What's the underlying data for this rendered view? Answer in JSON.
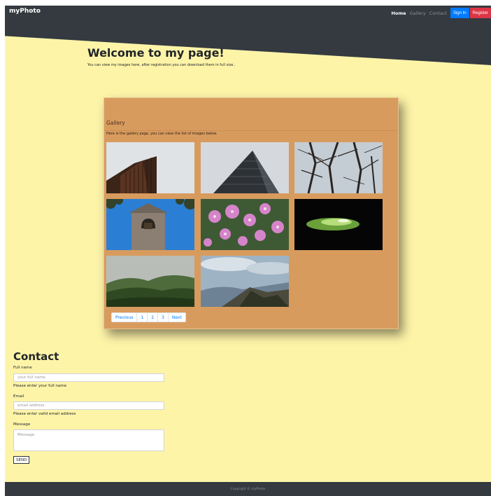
{
  "navbar": {
    "brand": "myPhoto",
    "links": [
      "Home",
      "Gallery",
      "Contact"
    ],
    "signin_label": "Sign In",
    "register_label": "Register"
  },
  "hero": {
    "title": "Welcome to my page!",
    "subtitle": "You can view my images here, after registration you can download them in full size.."
  },
  "gallery": {
    "title": "Gallery",
    "description": "Here is the gallery page, you can view the list of images below.",
    "images": [
      "tall-brown-building-photo",
      "glass-skyscraper-photo",
      "bare-trees-photo",
      "bell-tower-photo",
      "pink-flowers-photo",
      "mossy-rock-dark-photo",
      "green-forest-hills-photo",
      "mountain-ridge-clouds-photo"
    ],
    "pagination": [
      "Previous",
      "1",
      "2",
      "3",
      "Next"
    ]
  },
  "contact": {
    "title": "Contact",
    "fullname_label": "Full name",
    "fullname_placeholder": "your full name",
    "fullname_help": "Please enter your full name",
    "email_label": "Email",
    "email_placeholder": "email address",
    "email_help": "Please enter valid email address",
    "message_label": "Message",
    "message_placeholder": "Message",
    "send_label": "SEND"
  },
  "footer": {
    "copyright": "Copyright © myPhoto"
  }
}
